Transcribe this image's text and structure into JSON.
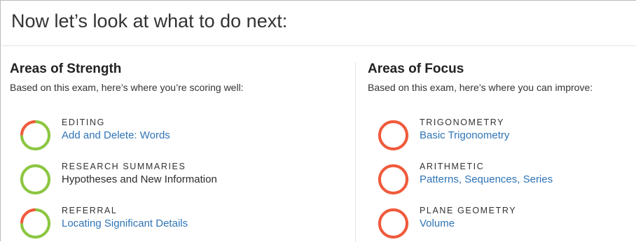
{
  "page": {
    "title": "Now let’s look at what to do next:"
  },
  "strength": {
    "heading": "Areas of Strength",
    "subtitle": "Based on this exam, here’s where you’re scoring well:",
    "items": [
      {
        "category": "EDITING",
        "topic": "Add and Delete: Words",
        "is_link": true,
        "score_fraction": 0.75
      },
      {
        "category": "RESEARCH SUMMARIES",
        "topic": "Hypotheses and New Information",
        "is_link": false,
        "score_fraction": 1.0
      },
      {
        "category": "REFERRAL",
        "topic": "Locating Significant Details",
        "is_link": true,
        "score_fraction": 0.75
      }
    ]
  },
  "focus": {
    "heading": "Areas of Focus",
    "subtitle": "Based on this exam, here’s where you can improve:",
    "items": [
      {
        "category": "TRIGONOMETRY",
        "topic": "Basic Trigonometry",
        "is_link": true,
        "score_fraction": 0.0
      },
      {
        "category": "ARITHMETIC",
        "topic": "Patterns, Sequences, Series",
        "is_link": true,
        "score_fraction": 0.0
      },
      {
        "category": "PLANE GEOMETRY",
        "topic": "Volume",
        "is_link": true,
        "score_fraction": 0.0
      }
    ]
  },
  "colors": {
    "correct": "#8cc641",
    "incorrect": "#f05a3c",
    "link": "#2f74b6"
  }
}
